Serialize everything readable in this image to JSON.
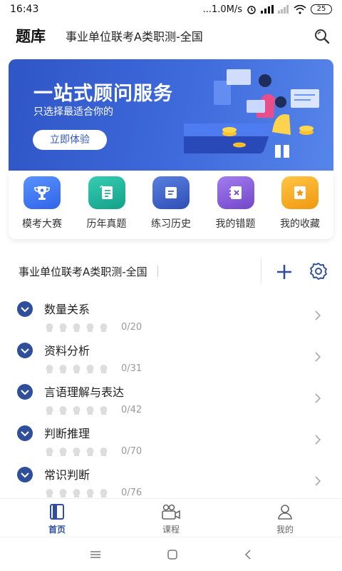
{
  "status_bar": {
    "time": "16:43",
    "network": "...1.0M/s",
    "battery": "25"
  },
  "header": {
    "title": "题库",
    "subject": "事业单位联考A类职测-全国"
  },
  "banner": {
    "title": "一站式顾问服务",
    "subtitle": "只选择最适合你的",
    "button": "立即体验"
  },
  "quick_actions": [
    {
      "label": "模考大赛",
      "icon": "trophy-icon",
      "color": "#3f76f0"
    },
    {
      "label": "历年真题",
      "icon": "scroll-icon",
      "color": "#1fb39d"
    },
    {
      "label": "练习历史",
      "icon": "document-icon",
      "color": "#3a5ec9"
    },
    {
      "label": "我的错题",
      "icon": "error-book-icon",
      "color": "#8a5bd6"
    },
    {
      "label": "我的收藏",
      "icon": "star-icon",
      "color": "#f2a51f"
    }
  ],
  "subject_bar": {
    "name": "事业单位联考A类职测-全国"
  },
  "categories": [
    {
      "name": "数量关系",
      "count": "0/20"
    },
    {
      "name": "资料分析",
      "count": "0/31"
    },
    {
      "name": "言语理解与表达",
      "count": "0/42"
    },
    {
      "name": "判断推理",
      "count": "0/70"
    },
    {
      "name": "常识判断",
      "count": "0/76"
    }
  ],
  "bottom_nav": [
    {
      "label": "首页",
      "icon": "book-icon",
      "active": true
    },
    {
      "label": "课程",
      "icon": "video-icon",
      "active": false
    },
    {
      "label": "我的",
      "icon": "profile-icon",
      "active": false
    }
  ],
  "colors": {
    "primary": "#2f4f9b",
    "banner": "#3f6bdc"
  }
}
